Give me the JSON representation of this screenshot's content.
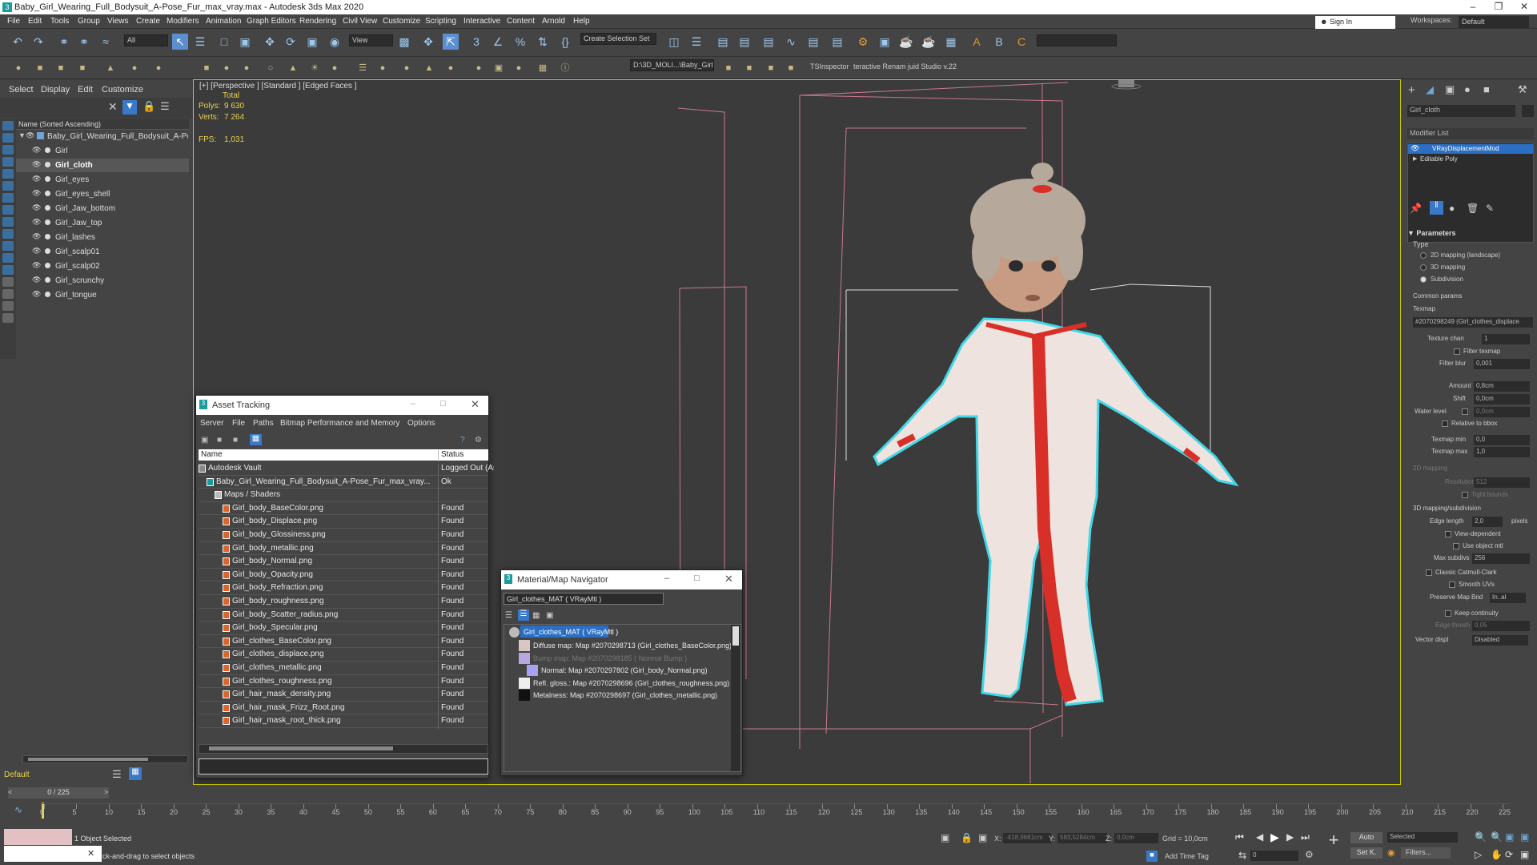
{
  "window": {
    "title": "Baby_Girl_Wearing_Full_Bodysuit_A-Pose_Fur_max_vray.max - Autodesk 3ds Max 2020",
    "app_icon": "3"
  },
  "menu": [
    "File",
    "Edit",
    "Tools",
    "Group",
    "Views",
    "Create",
    "Modifiers",
    "Animation",
    "Graph Editors",
    "Rendering",
    "Civil View",
    "Customize",
    "Scripting",
    "Interactive",
    "Content",
    "Arnold",
    "Help"
  ],
  "signin": "Sign In",
  "workspace": {
    "label": "Workspaces:",
    "value": "Default"
  },
  "toolbar": {
    "filter": "All",
    "view": "View",
    "selection_set": "Create Selection Set",
    "path": "D:\\3D_MOLI...\\Baby_Girl",
    "ts_inspector": "TSInspector",
    "renamer": "teractive Renam  juid Studio v.22"
  },
  "explorer": {
    "tabs": [
      "Select",
      "Display",
      "Edit",
      "Customize"
    ],
    "sort_header": "Name (Sorted Ascending)",
    "root": "Baby_Girl_Wearing_Full_Bodysuit_A-Pose_F",
    "items": [
      "Girl",
      "Girl_cloth",
      "Girl_eyes",
      "Girl_eyes_shell",
      "Girl_Jaw_bottom",
      "Girl_Jaw_top",
      "Girl_lashes",
      "Girl_scalp01",
      "Girl_scalp02",
      "Girl_scrunchy",
      "Girl_tongue"
    ],
    "selected": "Girl_cloth",
    "layer": "Default",
    "frame": "0 / 225"
  },
  "viewport": {
    "label": "[+] [Perspective ] [Standard ] [Edged Faces ]",
    "stats": {
      "total": "Total",
      "polys_label": "Polys:",
      "polys": "9 630",
      "verts_label": "Verts:",
      "verts": "7 264",
      "fps_label": "FPS:",
      "fps": "1,031"
    }
  },
  "asset_tracking": {
    "title": "Asset Tracking",
    "menu": [
      "Server",
      "File",
      "Paths",
      "Bitmap Performance and Memory",
      "Options"
    ],
    "columns": [
      "Name",
      "Status"
    ],
    "rows": [
      {
        "name": "Autodesk Vault",
        "status": "Logged Out (As",
        "indent": 0
      },
      {
        "name": "Baby_Girl_Wearing_Full_Bodysuit_A-Pose_Fur_max_vray...",
        "status": "Ok",
        "indent": 1
      },
      {
        "name": "Maps / Shaders",
        "status": "",
        "indent": 2
      },
      {
        "name": "Girl_body_BaseColor.png",
        "status": "Found",
        "indent": 3
      },
      {
        "name": "Girl_body_Displace.png",
        "status": "Found",
        "indent": 3
      },
      {
        "name": "Girl_body_Glossiness.png",
        "status": "Found",
        "indent": 3
      },
      {
        "name": "Girl_body_metallic.png",
        "status": "Found",
        "indent": 3
      },
      {
        "name": "Girl_body_Normal.png",
        "status": "Found",
        "indent": 3
      },
      {
        "name": "Girl_body_Opacity.png",
        "status": "Found",
        "indent": 3
      },
      {
        "name": "Girl_body_Refraction.png",
        "status": "Found",
        "indent": 3
      },
      {
        "name": "Girl_body_roughness.png",
        "status": "Found",
        "indent": 3
      },
      {
        "name": "Girl_body_Scatter_radius.png",
        "status": "Found",
        "indent": 3
      },
      {
        "name": "Girl_body_Specular.png",
        "status": "Found",
        "indent": 3
      },
      {
        "name": "Girl_clothes_BaseColor.png",
        "status": "Found",
        "indent": 3
      },
      {
        "name": "Girl_clothes_displace.png",
        "status": "Found",
        "indent": 3
      },
      {
        "name": "Girl_clothes_metallic.png",
        "status": "Found",
        "indent": 3
      },
      {
        "name": "Girl_clothes_roughness.png",
        "status": "Found",
        "indent": 3
      },
      {
        "name": "Girl_hair_mask_density.png",
        "status": "Found",
        "indent": 3
      },
      {
        "name": "Girl_hair_mask_Frizz_Root.png",
        "status": "Found",
        "indent": 3
      },
      {
        "name": "Girl_hair_mask_root_thick.png",
        "status": "Found",
        "indent": 3
      }
    ]
  },
  "navigator": {
    "title": "Material/Map Navigator",
    "field": "Girl_clothes_MAT  ( VRayMtl )",
    "root": "Girl_clothes_MAT  ( VRayMtl )",
    "rows": [
      {
        "text": "Diffuse map: Map #2070298713 (Girl_clothes_BaseColor.png)",
        "dim": false
      },
      {
        "text": "Bump map: Map #2070298185  ( Normal Bump )",
        "dim": true
      },
      {
        "text": "Normal: Map #2070297802 (Girl_body_Normal.png)",
        "dim": false
      },
      {
        "text": "Refl. gloss.: Map #2070298696 (Girl_clothes_roughness.png)",
        "dim": false
      },
      {
        "text": "Metalness: Map #2070298697 (Girl_clothes_metallic.png)",
        "dim": false
      }
    ]
  },
  "command_panel": {
    "object_name": "Girl_cloth",
    "modifier_list": "Modifier List",
    "stack": [
      "VRayDisplacementMod",
      "Editable Poly"
    ],
    "parameters": "Parameters",
    "type_label": "Type",
    "types": [
      "2D mapping (landscape)",
      "3D mapping",
      "Subdivision"
    ],
    "common": "Common params",
    "texmap_label": "Texmap",
    "texmap": "#2070298249 (Girl_clothes_displace",
    "texture_chan_label": "Texture chan",
    "texture_chan": "1",
    "filter_texmap": "Filter texmap",
    "filter_blur_label": "Filter blur",
    "filter_blur": "0,001",
    "amount_label": "Amount",
    "amount": "0,8cm",
    "shift_label": "Shift",
    "shift": "0,0cm",
    "water_label": "Water level",
    "water": "0,0cm",
    "relative": "Relative to bbox",
    "texmap_min_label": "Texmap min",
    "texmap_min": "0,0",
    "texmap_max_label": "Texmap max",
    "texmap_max": "1,0",
    "map2d": "2D mapping",
    "resolution_label": "Resolution",
    "resolution": "512",
    "tight": "Tight bounds",
    "map3d": "3D mapping/subdivision",
    "edge_label": "Edge length",
    "edge": "2,0",
    "pixels": "pixels",
    "view_dep": "View-dependent",
    "use_obj": "Use object mtl",
    "max_subdivs_label": "Max subdivs",
    "max_subdivs": "256",
    "classic": "Classic Catmull-Clark",
    "smooth_uvs": "Smooth UVs",
    "preserve_label": "Preserve Map Bnd",
    "preserve": "In..al",
    "keep": "Keep continuity",
    "edge_thresh_label": "Edge thresh",
    "edge_thresh": "0,05",
    "vector_label": "Vector displ",
    "vector": "Disabled"
  },
  "status": {
    "selected": "1 Object Selected",
    "prompt": "ck-and-drag to select objects",
    "x_label": "X:",
    "x": "-418,9681cm",
    "y_label": "Y:",
    "y": "583,5284cm",
    "z_label": "Z:",
    "z": "0,0cm",
    "grid": "Grid = 10,0cm",
    "add_time_tag": "Add Time Tag",
    "auto": "Auto",
    "set_key": "Set K.",
    "selected_mode": "Selected",
    "filters": "Filters...",
    "frame_field": "0"
  },
  "timeline": {
    "ticks": [
      "0",
      "5",
      "10",
      "15",
      "20",
      "25",
      "30",
      "35",
      "40",
      "45",
      "50",
      "55",
      "60",
      "65",
      "70",
      "75",
      "80",
      "85",
      "90",
      "95",
      "100",
      "105",
      "110",
      "115",
      "120",
      "125",
      "130",
      "135",
      "140",
      "145",
      "150",
      "155",
      "160",
      "165",
      "170",
      "175",
      "180",
      "185",
      "190",
      "195",
      "200",
      "205",
      "210",
      "215",
      "220",
      "225"
    ]
  },
  "colors": {
    "accent": "#1d9a9a",
    "selection": "#41d7e6",
    "highlight": "#2b6fc4",
    "stat": "#e8d34a"
  }
}
